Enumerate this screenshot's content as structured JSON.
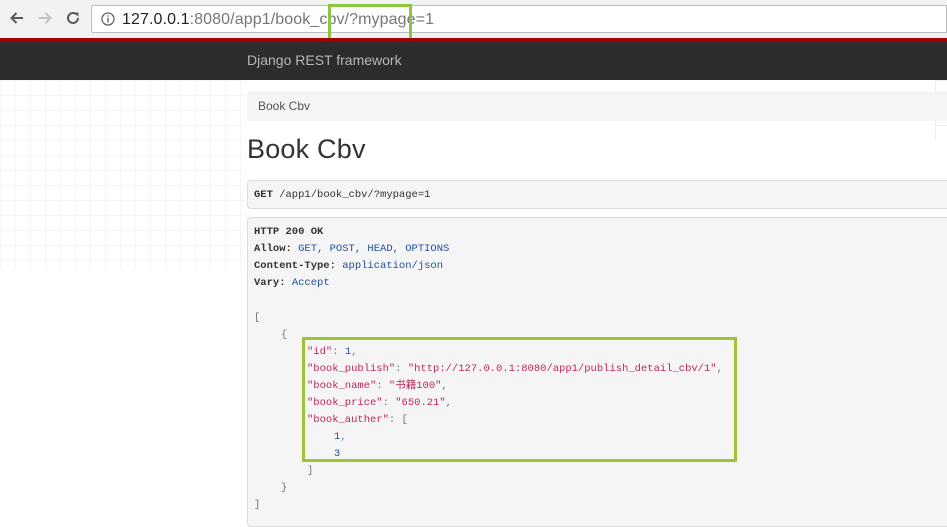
{
  "browser": {
    "url_host": "127.0.0.1",
    "url_path": ":8080/app1/book_cbv/",
    "url_query": "?mypage=1"
  },
  "navbar": {
    "brand": "Django REST framework"
  },
  "breadcrumb": {
    "item": "Book Cbv"
  },
  "page": {
    "title": "Book Cbv"
  },
  "request": {
    "method": "GET",
    "path": " /app1/book_cbv/?mypage=1"
  },
  "response": {
    "status": "HTTP 200 OK",
    "headers": [
      {
        "name": "Allow:",
        "value": " GET, POST, HEAD, OPTIONS"
      },
      {
        "name": "Content-Type:",
        "value": " application/json"
      },
      {
        "name": "Vary:",
        "value": " Accept"
      }
    ],
    "body": {
      "open_bracket": "[",
      "open_brace": "{",
      "fields": [
        {
          "key": "\"id\"",
          "value": "1",
          "sep": ": ",
          "trail": ",",
          "type": "num"
        },
        {
          "key": "\"book_publish\"",
          "value": "\"http://127.0.0.1:8080/app1/publish_detail_cbv/1\"",
          "sep": ": ",
          "trail": ",",
          "type": "str"
        },
        {
          "key": "\"book_name\"",
          "value": "\"书籍100\"",
          "sep": ": ",
          "trail": ",",
          "type": "str"
        },
        {
          "key": "\"book_price\"",
          "value": "\"650.21\"",
          "sep": ": ",
          "trail": ",",
          "type": "str"
        },
        {
          "key": "\"book_auther\"",
          "value": "[",
          "sep": ": ",
          "trail": "",
          "type": "pun"
        }
      ],
      "auther_items": [
        "1",
        "3"
      ],
      "auther_item_seps": [
        ",",
        ""
      ],
      "close_inner_bracket": "]",
      "close_brace": "}",
      "close_bracket": "]"
    }
  },
  "colors": {
    "highlight_border": "#8cc63f",
    "navbar_bg": "#2c2c2c",
    "accent_red": "#a30000"
  }
}
